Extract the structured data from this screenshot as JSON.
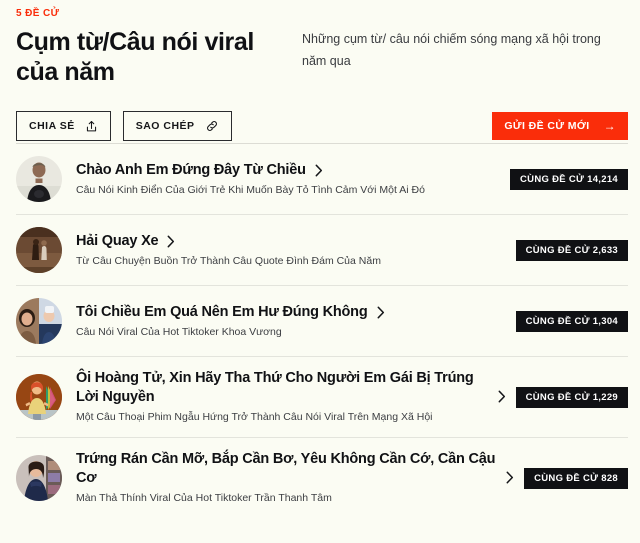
{
  "header": {
    "eyebrow": "5 ĐỀ CỬ",
    "title": "Cụm từ/Câu nói viral của năm",
    "description": "Những cụm từ/ câu nói chiếm sóng mạng xã hội trong năm qua"
  },
  "actions": {
    "share_label": "CHIA SẺ",
    "copy_label": "SAO CHÉP",
    "submit_label": "GỬI ĐỀ CỬ MỚI",
    "submit_arrow": "→",
    "accent_color": "#FA2D0A"
  },
  "nominees": [
    {
      "title": "Chào Anh Em Đứng Đây Từ Chiều",
      "subtitle": "Câu Nói Kinh Điển Của Giới Trẻ Khi Muốn Bày Tỏ Tình Cảm Với Một Ai Đó",
      "vote_label": "CÙNG ĐỀ CỬ 14,214"
    },
    {
      "title": "Hải Quay Xe",
      "subtitle": "Từ Câu Chuyện Buồn Trở Thành Câu Quote Đình Đám Của Năm",
      "vote_label": "CÙNG ĐỀ CỬ 2,633"
    },
    {
      "title": "Tôi Chiều Em Quá Nên Em Hư Đúng Không",
      "subtitle": "Câu Nói Viral Của Hot Tiktoker Khoa Vương",
      "vote_label": "CÙNG ĐỀ CỬ 1,304"
    },
    {
      "title": "Ôi Hoàng Tử, Xin Hãy Tha Thứ Cho Người Em Gái Bị Trúng Lời Nguyền",
      "subtitle": "Một Câu Thoại Phim Ngẫu Hứng Trở Thành Câu Nói Viral Trên Mạng Xã Hội",
      "vote_label": "CÙNG ĐỀ CỬ 1,229"
    },
    {
      "title": "Trứng Rán Cần Mỡ, Bắp Cần Bơ, Yêu Không Cần Cớ, Cần Cậu Cơ",
      "subtitle": "Màn Thả Thính Viral Của Hot Tiktoker Trần Thanh Tâm",
      "vote_label": "CÙNG ĐỀ CỬ 828"
    }
  ]
}
